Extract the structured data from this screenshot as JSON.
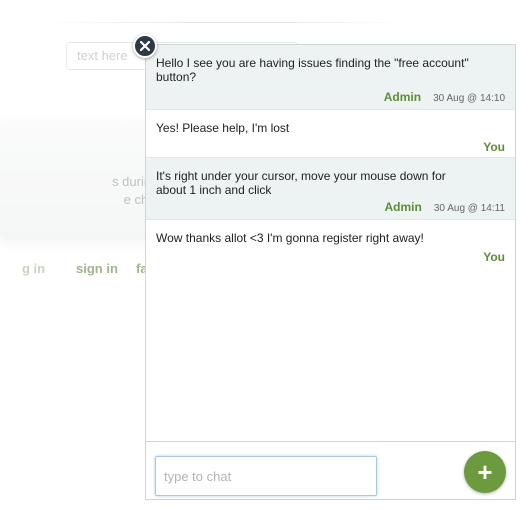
{
  "background": {
    "input_placeholder": "text here",
    "card_lines": [
      "s during the",
      "e chatbox"
    ],
    "links": [
      "g in",
      "sign in",
      "fa"
    ]
  },
  "chat": {
    "close_icon": "close-icon",
    "messages": [
      {
        "sender": "Admin",
        "text": "Hello I see you are having issues finding the \"free account\" button?",
        "time": "30 Aug @ 14:10"
      },
      {
        "sender": "You",
        "text": "Yes! Please help, I'm lost",
        "time": ""
      },
      {
        "sender": "Admin",
        "text": "It's right under your cursor, move your mouse down for about 1 inch and click",
        "time": "30 Aug @ 14:11"
      },
      {
        "sender": "You",
        "text": "Wow thanks allot <3 I'm gonna register right away!",
        "time": ""
      }
    ],
    "input_placeholder": "type to chat",
    "input_value": "",
    "add_button_glyph": "+",
    "add_icon": "plus-icon"
  },
  "colors": {
    "accent_green": "#6b9a3f",
    "author_green": "#5e8c3a",
    "admin_bg": "#edf2f2",
    "close_bg": "#2f3a48"
  }
}
